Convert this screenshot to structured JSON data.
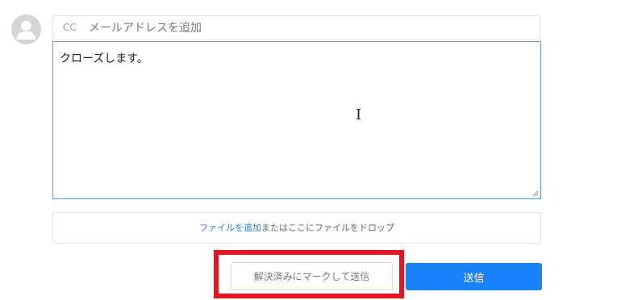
{
  "cc": {
    "label": "CC",
    "placeholder": "メールアドレスを追加"
  },
  "message": {
    "text": "クローズします。"
  },
  "attachments": {
    "link_label": "ファイルを追加",
    "hint_text": "またはここにファイルをドロップ"
  },
  "actions": {
    "resolve_send_label": "解決済みにマークして送信",
    "send_label": "送信"
  },
  "colors": {
    "primary": "#1a82fb",
    "highlight": "#e8141f",
    "link": "#2f7fd6",
    "focus_border": "#5b9dd9"
  },
  "icons": {
    "avatar": "user-avatar-icon",
    "text_cursor": "i-beam-cursor-icon",
    "resize": "resize-grip-icon"
  }
}
